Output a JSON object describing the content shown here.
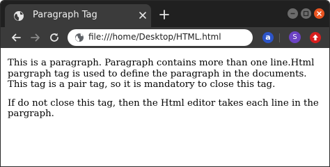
{
  "tab": {
    "title": "Paragraph Tag"
  },
  "address_bar": {
    "url": "file:///home/Desktop/HTML.html"
  },
  "extensions": {
    "a_letter": "a",
    "s_letter": "S"
  },
  "page": {
    "paragraphs": [
      "This is a paragraph. Paragraph contains more than one line.Html pargraph tag is used to define the paragraph in the documents. This tag is a pair tag, so it is mandatory to close this tag.",
      "If do not close this tag, then the Html editor takes each line in the pargraph."
    ]
  },
  "colors": {
    "titlebar": "#202020",
    "toolbar": "#3b3b3b",
    "close_button": "#e95420",
    "ext_a": "#2c54c8",
    "ext_s": "#6c43c4",
    "ext_up": "#d81e1e"
  }
}
